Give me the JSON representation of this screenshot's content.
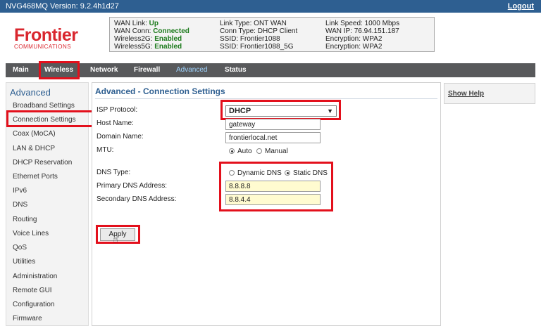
{
  "topbar": {
    "version": "NVG468MQ Version: 9.2.4h1d27",
    "logout": "Logout"
  },
  "logo": {
    "brand": "Frontier",
    "sub": "COMMUNICATIONS"
  },
  "status": {
    "col1": [
      {
        "k": "WAN Link: ",
        "v": "Up"
      },
      {
        "k": "WAN Conn: ",
        "v": "Connected"
      },
      {
        "k": "Wireless2G: ",
        "v": "Enabled"
      },
      {
        "k": "Wireless5G: ",
        "v": "Enabled"
      }
    ],
    "col2": [
      "Link Type: ONT WAN",
      "Conn Type: DHCP Client",
      "SSID: Frontier1088",
      "SSID: Frontier1088_5G"
    ],
    "col3": [
      "Link Speed: 1000 Mbps",
      "WAN IP: 76.94.151.187",
      "Encryption: WPA2",
      "Encryption: WPA2"
    ]
  },
  "nav": [
    "Main",
    "Wireless",
    "Network",
    "Firewall",
    "Advanced",
    "Status"
  ],
  "sidebar": {
    "title": "Advanced",
    "items": [
      "Broadband Settings",
      "Connection Settings",
      "Coax (MoCA)",
      "LAN & DHCP",
      "DHCP Reservation",
      "Ethernet Ports",
      "IPv6",
      "DNS",
      "Routing",
      "Voice Lines",
      "QoS",
      "Utilities",
      "Administration",
      "Remote GUI",
      "Configuration",
      "Firmware"
    ]
  },
  "content": {
    "heading": "Advanced - Connection Settings",
    "isp_protocol_label": "ISP Protocol:",
    "isp_protocol_value": "DHCP",
    "host_name_label": "Host Name:",
    "host_name_value": "gateway",
    "domain_name_label": "Domain Name:",
    "domain_name_value": "frontierlocal.net",
    "mtu_label": "MTU:",
    "mtu_auto": "Auto",
    "mtu_manual": "Manual",
    "dns_type_label": "DNS Type:",
    "dns_dynamic": "Dynamic DNS",
    "dns_static": "Static DNS",
    "primary_dns_label": "Primary DNS Address:",
    "primary_dns_value": "8.8.8.8",
    "secondary_dns_label": "Secondary DNS Address:",
    "secondary_dns_value": "8.8.4.4",
    "apply": "Apply"
  },
  "help": {
    "link": "Show Help"
  },
  "colors": {
    "brand_red": "#d9262e",
    "header_blue": "#2e5f91",
    "nav_gray": "#58595b",
    "highlight": "#e3101c"
  }
}
